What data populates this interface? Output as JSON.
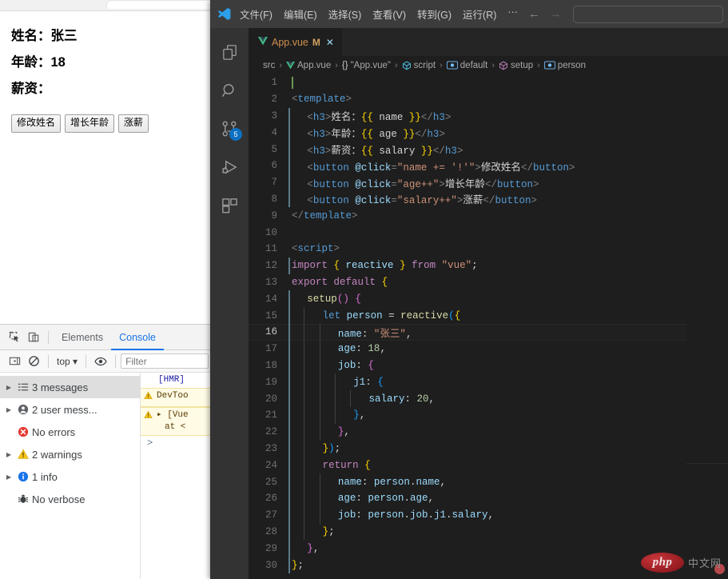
{
  "browser": {
    "page": {
      "fields": [
        {
          "label": "姓名：",
          "value": "张三"
        },
        {
          "label": "年龄：",
          "value": "18"
        },
        {
          "label": "薪资：",
          "value": ""
        }
      ],
      "buttons": [
        {
          "label": "修改姓名"
        },
        {
          "label": "增长年龄"
        },
        {
          "label": "涨薪"
        }
      ]
    }
  },
  "devtools": {
    "toolbar": {
      "inspect_icon": "inspect-element-icon",
      "device_icon": "device-toolbar-icon",
      "tabs": [
        {
          "label": "Elements",
          "active": false
        },
        {
          "label": "Console",
          "active": true
        }
      ]
    },
    "filterbar": {
      "sidebar_toggle_icon": "sidebar-toggle-icon",
      "clear_icon": "clear-console-icon",
      "context": "top",
      "eye_icon": "live-expression-icon",
      "filter_placeholder": "Filter"
    },
    "sidebar": [
      {
        "label": "3 messages",
        "icon": "messages-icon",
        "expandable": true,
        "selected": true
      },
      {
        "label": "2 user mess...",
        "icon": "user-message-icon",
        "expandable": true,
        "selected": false
      },
      {
        "label": "No errors",
        "icon": "error-icon",
        "expandable": false,
        "selected": false
      },
      {
        "label": "2 warnings",
        "icon": "warning-icon",
        "expandable": true,
        "selected": false
      },
      {
        "label": "1 info",
        "icon": "info-icon",
        "expandable": true,
        "selected": false
      },
      {
        "label": "No verbose",
        "icon": "verbose-bug-icon",
        "expandable": false,
        "selected": false
      }
    ],
    "console_rows": [
      {
        "kind": "log",
        "text": "[HMR]"
      },
      {
        "kind": "warning",
        "text": "DevToo"
      },
      {
        "kind": "warning",
        "text": "▸ [Vue",
        "text2": "at <"
      },
      {
        "kind": "prompt",
        "text": ">"
      }
    ]
  },
  "vscode": {
    "titlebar": {
      "logo": "vscode-logo-icon",
      "menus": [
        "文件(F)",
        "编辑(E)",
        "选择(S)",
        "查看(V)",
        "转到(G)",
        "运行(R)",
        "···"
      ],
      "nav_back": "←",
      "nav_forward": "→",
      "command_bar_value": ""
    },
    "activitybar": [
      {
        "name": "explorer",
        "icon": "files-explorer-icon",
        "badge": null
      },
      {
        "name": "search",
        "icon": "search-icon",
        "badge": null
      },
      {
        "name": "source-control",
        "icon": "source-control-icon",
        "badge": "5"
      },
      {
        "name": "run-and-debug",
        "icon": "run-debug-icon",
        "badge": null
      },
      {
        "name": "extensions",
        "icon": "extensions-icon",
        "badge": null
      }
    ],
    "tab": {
      "icon": "vue-file-icon",
      "label": "App.vue",
      "dirty": "M",
      "close": "✕"
    },
    "breadcrumbs": [
      {
        "icon": null,
        "label": "src"
      },
      {
        "icon": "vue-file-icon",
        "label": "App.vue"
      },
      {
        "icon": "{}",
        "label": "\"App.vue\""
      },
      {
        "icon": "module-icon",
        "label": "script"
      },
      {
        "icon": "property-icon",
        "label": "default"
      },
      {
        "icon": "method-icon",
        "label": "setup"
      },
      {
        "icon": "property-icon",
        "label": "person"
      }
    ],
    "editor": {
      "active_line": 16,
      "lines": [
        {
          "n": 1,
          "indent": 0,
          "tokens": [],
          "caret": true
        },
        {
          "n": 2,
          "indent": 0,
          "tokens": [
            {
              "t": "<",
              "c": "t-punct"
            },
            {
              "t": "template",
              "c": "t-tag"
            },
            {
              "t": ">",
              "c": "t-punct"
            }
          ]
        },
        {
          "n": 3,
          "indent": 1,
          "tokens": [
            {
              "t": "<",
              "c": "t-punct"
            },
            {
              "t": "h3",
              "c": "t-tag"
            },
            {
              "t": ">",
              "c": "t-punct"
            },
            {
              "t": "姓名：",
              "c": "t-txt"
            },
            {
              "t": "{{",
              "c": "t-mus"
            },
            {
              "t": " name ",
              "c": "t-txt"
            },
            {
              "t": "}}",
              "c": "t-mus"
            },
            {
              "t": "</",
              "c": "t-punct"
            },
            {
              "t": "h3",
              "c": "t-tag"
            },
            {
              "t": ">",
              "c": "t-punct"
            }
          ]
        },
        {
          "n": 4,
          "indent": 1,
          "tokens": [
            {
              "t": "<",
              "c": "t-punct"
            },
            {
              "t": "h3",
              "c": "t-tag"
            },
            {
              "t": ">",
              "c": "t-punct"
            },
            {
              "t": "年龄：",
              "c": "t-txt"
            },
            {
              "t": "{{",
              "c": "t-mus"
            },
            {
              "t": " age ",
              "c": "t-txt"
            },
            {
              "t": "}}",
              "c": "t-mus"
            },
            {
              "t": "</",
              "c": "t-punct"
            },
            {
              "t": "h3",
              "c": "t-tag"
            },
            {
              "t": ">",
              "c": "t-punct"
            }
          ]
        },
        {
          "n": 5,
          "indent": 1,
          "tokens": [
            {
              "t": "<",
              "c": "t-punct"
            },
            {
              "t": "h3",
              "c": "t-tag"
            },
            {
              "t": ">",
              "c": "t-punct"
            },
            {
              "t": "薪资：",
              "c": "t-txt"
            },
            {
              "t": "{{",
              "c": "t-mus"
            },
            {
              "t": " salary ",
              "c": "t-txt"
            },
            {
              "t": "}}",
              "c": "t-mus"
            },
            {
              "t": "</",
              "c": "t-punct"
            },
            {
              "t": "h3",
              "c": "t-tag"
            },
            {
              "t": ">",
              "c": "t-punct"
            }
          ]
        },
        {
          "n": 6,
          "indent": 1,
          "tokens": [
            {
              "t": "<",
              "c": "t-punct"
            },
            {
              "t": "button",
              "c": "t-tag"
            },
            {
              "t": " ",
              "c": "t-txt"
            },
            {
              "t": "@click",
              "c": "t-attr"
            },
            {
              "t": "=",
              "c": "t-punct"
            },
            {
              "t": "\"name += '!'\"",
              "c": "t-str"
            },
            {
              "t": ">",
              "c": "t-punct"
            },
            {
              "t": "修改姓名",
              "c": "t-txt"
            },
            {
              "t": "</",
              "c": "t-punct"
            },
            {
              "t": "button",
              "c": "t-tag"
            },
            {
              "t": ">",
              "c": "t-punct"
            }
          ]
        },
        {
          "n": 7,
          "indent": 1,
          "tokens": [
            {
              "t": "<",
              "c": "t-punct"
            },
            {
              "t": "button",
              "c": "t-tag"
            },
            {
              "t": " ",
              "c": "t-txt"
            },
            {
              "t": "@click",
              "c": "t-attr"
            },
            {
              "t": "=",
              "c": "t-punct"
            },
            {
              "t": "\"age++\"",
              "c": "t-str"
            },
            {
              "t": ">",
              "c": "t-punct"
            },
            {
              "t": "增长年龄",
              "c": "t-txt"
            },
            {
              "t": "</",
              "c": "t-punct"
            },
            {
              "t": "button",
              "c": "t-tag"
            },
            {
              "t": ">",
              "c": "t-punct"
            }
          ]
        },
        {
          "n": 8,
          "indent": 1,
          "tokens": [
            {
              "t": "<",
              "c": "t-punct"
            },
            {
              "t": "button",
              "c": "t-tag"
            },
            {
              "t": " ",
              "c": "t-txt"
            },
            {
              "t": "@click",
              "c": "t-attr"
            },
            {
              "t": "=",
              "c": "t-punct"
            },
            {
              "t": "\"salary++\"",
              "c": "t-str"
            },
            {
              "t": ">",
              "c": "t-punct"
            },
            {
              "t": "涨薪",
              "c": "t-txt"
            },
            {
              "t": "</",
              "c": "t-punct"
            },
            {
              "t": "button",
              "c": "t-tag"
            },
            {
              "t": ">",
              "c": "t-punct"
            }
          ]
        },
        {
          "n": 9,
          "indent": 0,
          "tokens": [
            {
              "t": "</",
              "c": "t-punct"
            },
            {
              "t": "template",
              "c": "t-tag"
            },
            {
              "t": ">",
              "c": "t-punct"
            }
          ]
        },
        {
          "n": 10,
          "indent": 0,
          "tokens": []
        },
        {
          "n": 11,
          "indent": 0,
          "tokens": [
            {
              "t": "<",
              "c": "t-punct"
            },
            {
              "t": "script",
              "c": "t-tag"
            },
            {
              "t": ">",
              "c": "t-punct"
            }
          ]
        },
        {
          "n": 12,
          "indent": 0,
          "tokens": [
            {
              "t": "import",
              "c": "t-kw"
            },
            {
              "t": " ",
              "c": "t-txt"
            },
            {
              "t": "{",
              "c": "t-brace1"
            },
            {
              "t": " reactive ",
              "c": "t-var"
            },
            {
              "t": "}",
              "c": "t-brace1"
            },
            {
              "t": " ",
              "c": "t-txt"
            },
            {
              "t": "from",
              "c": "t-kw"
            },
            {
              "t": " ",
              "c": "t-txt"
            },
            {
              "t": "\"vue\"",
              "c": "t-str"
            },
            {
              "t": ";",
              "c": "t-txt"
            }
          ]
        },
        {
          "n": 13,
          "indent": 0,
          "tokens": [
            {
              "t": "export",
              "c": "t-kw"
            },
            {
              "t": " ",
              "c": "t-txt"
            },
            {
              "t": "default",
              "c": "t-kw"
            },
            {
              "t": " ",
              "c": "t-txt"
            },
            {
              "t": "{",
              "c": "t-brace1"
            }
          ]
        },
        {
          "n": 14,
          "indent": 1,
          "tokens": [
            {
              "t": "setup",
              "c": "t-fn"
            },
            {
              "t": "()",
              "c": "t-brace2"
            },
            {
              "t": " ",
              "c": "t-txt"
            },
            {
              "t": "{",
              "c": "t-brace2"
            }
          ]
        },
        {
          "n": 15,
          "indent": 2,
          "tokens": [
            {
              "t": "let",
              "c": "t-kw2"
            },
            {
              "t": " ",
              "c": "t-txt"
            },
            {
              "t": "person",
              "c": "t-var"
            },
            {
              "t": " = ",
              "c": "t-txt"
            },
            {
              "t": "reactive",
              "c": "t-fn"
            },
            {
              "t": "(",
              "c": "t-brace3"
            },
            {
              "t": "{",
              "c": "t-brace1"
            }
          ]
        },
        {
          "n": 16,
          "indent": 3,
          "tokens": [
            {
              "t": "name",
              "c": "t-var"
            },
            {
              "t": ": ",
              "c": "t-txt"
            },
            {
              "t": "\"张三\"",
              "c": "t-str"
            },
            {
              "t": ",",
              "c": "t-txt"
            }
          ]
        },
        {
          "n": 17,
          "indent": 3,
          "tokens": [
            {
              "t": "age",
              "c": "t-var"
            },
            {
              "t": ": ",
              "c": "t-txt"
            },
            {
              "t": "18",
              "c": "t-num"
            },
            {
              "t": ",",
              "c": "t-txt"
            }
          ]
        },
        {
          "n": 18,
          "indent": 3,
          "tokens": [
            {
              "t": "job",
              "c": "t-var"
            },
            {
              "t": ": ",
              "c": "t-txt"
            },
            {
              "t": "{",
              "c": "t-brace2"
            }
          ]
        },
        {
          "n": 19,
          "indent": 4,
          "tokens": [
            {
              "t": "j1",
              "c": "t-var"
            },
            {
              "t": ": ",
              "c": "t-txt"
            },
            {
              "t": "{",
              "c": "t-brace3"
            }
          ]
        },
        {
          "n": 20,
          "indent": 5,
          "tokens": [
            {
              "t": "salary",
              "c": "t-var"
            },
            {
              "t": ": ",
              "c": "t-txt"
            },
            {
              "t": "20",
              "c": "t-num"
            },
            {
              "t": ",",
              "c": "t-txt"
            }
          ]
        },
        {
          "n": 21,
          "indent": 4,
          "tokens": [
            {
              "t": "}",
              "c": "t-brace3"
            },
            {
              "t": ",",
              "c": "t-txt"
            }
          ]
        },
        {
          "n": 22,
          "indent": 3,
          "tokens": [
            {
              "t": "}",
              "c": "t-brace2"
            },
            {
              "t": ",",
              "c": "t-txt"
            }
          ]
        },
        {
          "n": 23,
          "indent": 2,
          "tokens": [
            {
              "t": "}",
              "c": "t-brace1"
            },
            {
              "t": ")",
              "c": "t-brace3"
            },
            {
              "t": ";",
              "c": "t-txt"
            }
          ]
        },
        {
          "n": 24,
          "indent": 2,
          "tokens": [
            {
              "t": "return",
              "c": "t-kw"
            },
            {
              "t": " ",
              "c": "t-txt"
            },
            {
              "t": "{",
              "c": "t-brace1"
            }
          ]
        },
        {
          "n": 25,
          "indent": 3,
          "tokens": [
            {
              "t": "name",
              "c": "t-var"
            },
            {
              "t": ": ",
              "c": "t-txt"
            },
            {
              "t": "person",
              "c": "t-var"
            },
            {
              "t": ".",
              "c": "t-txt"
            },
            {
              "t": "name",
              "c": "t-var"
            },
            {
              "t": ",",
              "c": "t-txt"
            }
          ]
        },
        {
          "n": 26,
          "indent": 3,
          "tokens": [
            {
              "t": "age",
              "c": "t-var"
            },
            {
              "t": ": ",
              "c": "t-txt"
            },
            {
              "t": "person",
              "c": "t-var"
            },
            {
              "t": ".",
              "c": "t-txt"
            },
            {
              "t": "age",
              "c": "t-var"
            },
            {
              "t": ",",
              "c": "t-txt"
            }
          ]
        },
        {
          "n": 27,
          "indent": 3,
          "tokens": [
            {
              "t": "job",
              "c": "t-var"
            },
            {
              "t": ": ",
              "c": "t-txt"
            },
            {
              "t": "person",
              "c": "t-var"
            },
            {
              "t": ".",
              "c": "t-txt"
            },
            {
              "t": "job",
              "c": "t-var"
            },
            {
              "t": ".",
              "c": "t-txt"
            },
            {
              "t": "j1",
              "c": "t-var"
            },
            {
              "t": ".",
              "c": "t-txt"
            },
            {
              "t": "salary",
              "c": "t-var"
            },
            {
              "t": ",",
              "c": "t-txt"
            }
          ]
        },
        {
          "n": 28,
          "indent": 2,
          "tokens": [
            {
              "t": "}",
              "c": "t-brace1"
            },
            {
              "t": ";",
              "c": "t-txt"
            }
          ]
        },
        {
          "n": 29,
          "indent": 1,
          "tokens": [
            {
              "t": "}",
              "c": "t-brace2"
            },
            {
              "t": ",",
              "c": "t-txt"
            }
          ]
        },
        {
          "n": 30,
          "indent": 0,
          "tokens": [
            {
              "t": "}",
              "c": "t-brace1"
            },
            {
              "t": ";",
              "c": "t-txt"
            }
          ]
        }
      ]
    }
  },
  "watermark": {
    "logo_text": "php",
    "site_text": "中文网"
  }
}
